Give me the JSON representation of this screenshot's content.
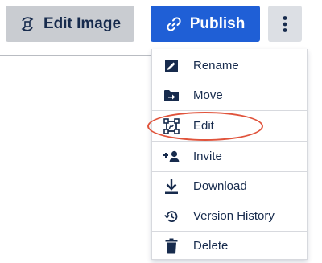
{
  "toolbar": {
    "edit_image_label": "Edit Image",
    "publish_label": "Publish",
    "more_icon": "vertical-dots-icon"
  },
  "colors": {
    "primary": "#1f5fd6",
    "secondary_button": "#c9ccd1",
    "more_button": "#dcdfe4",
    "text": "#172b4d",
    "highlight": "#e0533b"
  },
  "menu": {
    "items": [
      {
        "label": "Rename",
        "icon": "rename-pencil-icon"
      },
      {
        "label": "Move",
        "icon": "folder-move-icon"
      },
      {
        "label": "Edit",
        "icon": "edit-frame-icon"
      },
      {
        "label": "Invite",
        "icon": "add-person-icon"
      },
      {
        "label": "Download",
        "icon": "download-icon"
      },
      {
        "label": "Version History",
        "icon": "history-icon"
      },
      {
        "label": "Delete",
        "icon": "trash-icon"
      }
    ]
  }
}
